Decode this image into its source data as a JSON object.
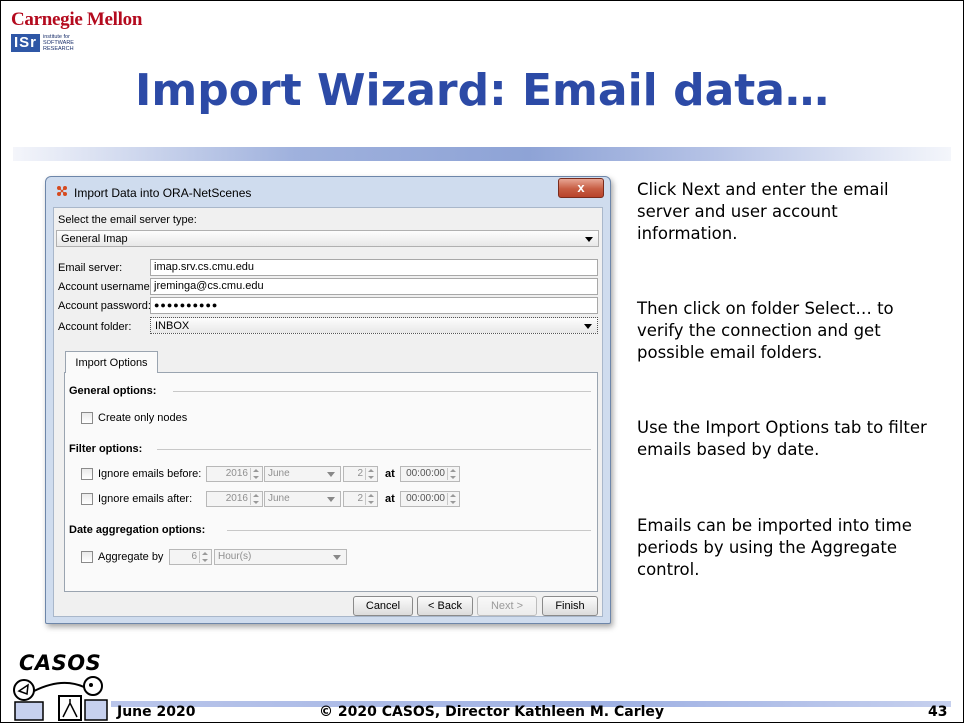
{
  "header": {
    "cmu_logo_text": "Carnegie Mellon",
    "isr_logo_mark": "ISr",
    "isr_logo_subtitle": "institute for SOFTWARE RESEARCH"
  },
  "slide_title": "Import Wizard: Email data…",
  "dialog": {
    "title": "Import Data into ORA-NetScenes",
    "close_label": "x",
    "server_type_label": "Select the email server type:",
    "server_type_value": "General Imap",
    "email_server_label": "Email server:",
    "email_server_value": "imap.srv.cs.cmu.edu",
    "username_label": "Account username:",
    "username_value": "jreminga@cs.cmu.edu",
    "password_label": "Account password:",
    "password_value": "●●●●●●●●●●",
    "folder_label": "Account folder:",
    "folder_value": "INBOX",
    "tab_label": "Import Options",
    "general_options_label": "General options:",
    "create_only_nodes_label": "Create only nodes",
    "filter_options_label": "Filter options:",
    "ignore_before_label": "Ignore emails before:",
    "ignore_after_label": "Ignore emails after:",
    "filter_year": "2016",
    "filter_month": "June",
    "filter_day": "2",
    "at_label": "at",
    "filter_time": "00:00:00",
    "date_aggregation_label": "Date aggregation options:",
    "aggregate_by_label": "Aggregate by",
    "aggregate_value": "6",
    "aggregate_unit": "Hour(s)",
    "buttons": {
      "cancel": "Cancel",
      "back": "< Back",
      "next": "Next >",
      "finish": "Finish"
    }
  },
  "description": {
    "p1": "Click Next and enter the email server and user account information.",
    "p2": "Then click on folder Select… to verify the connection and get possible email folders.",
    "p3": "Use the Import Options tab to filter emails based by date.",
    "p4": "Emails can be imported into time periods by using the Aggregate control."
  },
  "footer": {
    "casos_logo_text": "CASOS",
    "date": "June 2020",
    "copyright": "© 2020 CASOS, Director Kathleen M. Carley",
    "page_number": "43"
  },
  "colors": {
    "title_blue": "#2c4aa6",
    "cmu_red": "#b40a1e",
    "isr_blue": "#2f57a6"
  }
}
